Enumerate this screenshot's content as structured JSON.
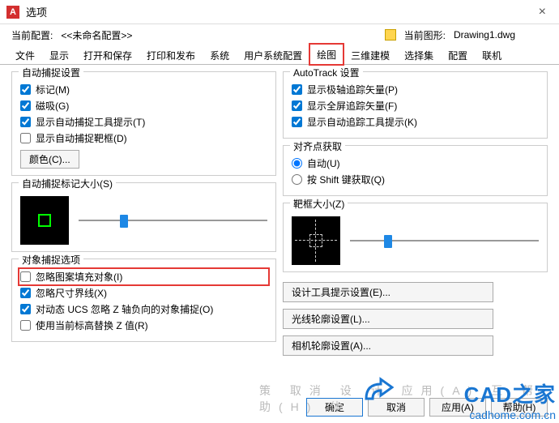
{
  "window": {
    "title": "选项",
    "close": "×",
    "app_letter": "A"
  },
  "profile": {
    "cur_label": "当前配置:",
    "cur_value": "<<未命名配置>>",
    "dwg_label": "当前图形:",
    "dwg_value": "Drawing1.dwg"
  },
  "tabs": [
    "文件",
    "显示",
    "打开和保存",
    "打印和发布",
    "系统",
    "用户系统配置",
    "绘图",
    "三维建模",
    "选择集",
    "配置",
    "联机"
  ],
  "active_tab": 6,
  "left": {
    "g1": {
      "legend": "自动捕捉设置",
      "opts": [
        {
          "label": "标记(M)",
          "checked": true
        },
        {
          "label": "磁吸(G)",
          "checked": true
        },
        {
          "label": "显示自动捕捉工具提示(T)",
          "checked": true
        },
        {
          "label": "显示自动捕捉靶框(D)",
          "checked": false
        }
      ],
      "color_btn": "颜色(C)..."
    },
    "g2": {
      "legend": "自动捕捉标记大小(S)"
    },
    "g3": {
      "legend": "对象捕捉选项",
      "opts": [
        {
          "label": "忽略图案填充对象(I)",
          "checked": false,
          "hl": true
        },
        {
          "label": "忽略尺寸界线(X)",
          "checked": true
        },
        {
          "label": "对动态 UCS 忽略 Z 轴负向的对象捕捉(O)",
          "checked": true
        },
        {
          "label": "使用当前标高替换 Z 值(R)",
          "checked": false
        }
      ]
    }
  },
  "right": {
    "g1": {
      "legend": "AutoTrack 设置",
      "opts": [
        {
          "label": "显示极轴追踪矢量(P)",
          "checked": true
        },
        {
          "label": "显示全屏追踪矢量(F)",
          "checked": true
        },
        {
          "label": "显示自动追踪工具提示(K)",
          "checked": true
        }
      ]
    },
    "g2": {
      "legend": "对齐点获取",
      "radios": [
        {
          "label": "自动(U)",
          "checked": true
        },
        {
          "label": "按 Shift 键获取(Q)",
          "checked": false
        }
      ]
    },
    "g3": {
      "legend": "靶框大小(Z)"
    },
    "btns": [
      "设计工具提示设置(E)...",
      "光线轮廓设置(L)...",
      "相机轮廓设置(A)..."
    ]
  },
  "footer": {
    "ok": "确定",
    "cancel": "取消",
    "apply": "应用(A)",
    "help": "帮助(H)"
  },
  "wm": {
    "brand": "CAD之家",
    "url": "cadhome.com.cn",
    "ghost": "策 取消 设 计 应用(A) 互 帮助(H) 体"
  }
}
